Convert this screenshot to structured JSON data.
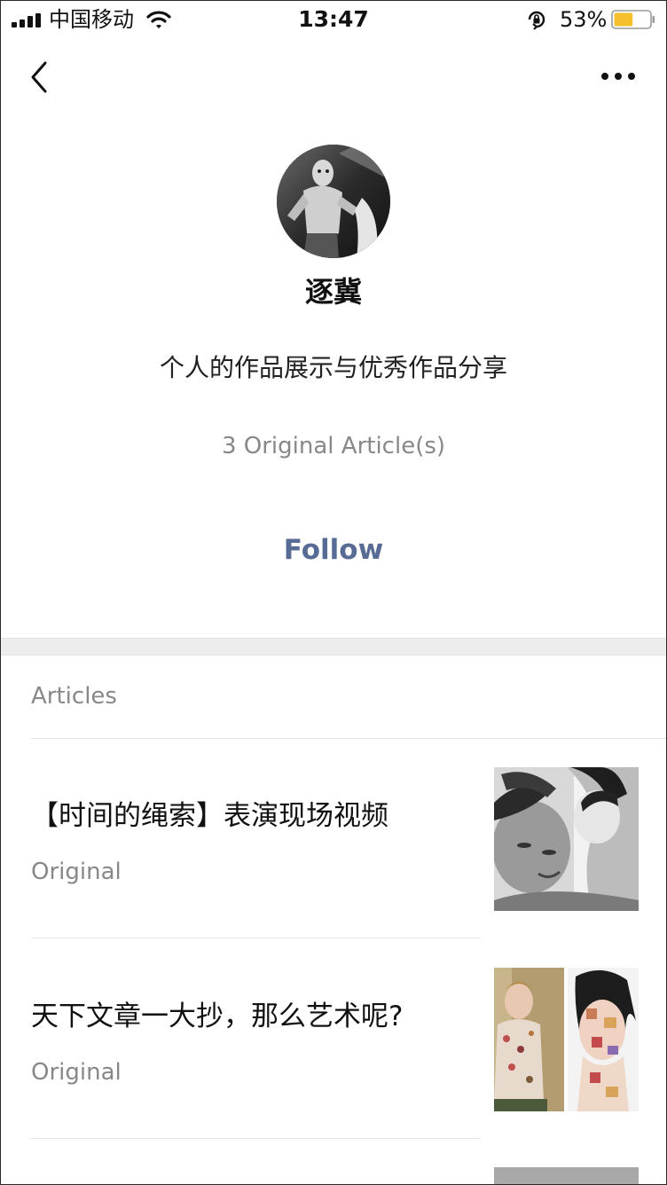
{
  "status_bar": {
    "carrier": "中国移动",
    "time": "13:47",
    "battery_percent": "53%",
    "battery_level": 0.53,
    "battery_color": "#f5c02b",
    "icons": [
      "signal-icon",
      "wifi-icon",
      "orientation-lock-icon",
      "battery-icon"
    ]
  },
  "nav": {
    "back_icon": "chevron-left-icon",
    "more_icon": "more-dots-icon"
  },
  "profile": {
    "name": "逐冀",
    "description": "个人的作品展示与优秀作品分享",
    "article_count": "3 Original Article(s)",
    "follow_label": "Follow",
    "accent_color": "#576b95"
  },
  "articles_section": {
    "title": "Articles",
    "items": [
      {
        "title": "【时间的绳索】表演现场视频",
        "tag": "Original"
      },
      {
        "title": "天下文章一大抄，那么艺术呢?",
        "tag": "Original"
      }
    ]
  }
}
